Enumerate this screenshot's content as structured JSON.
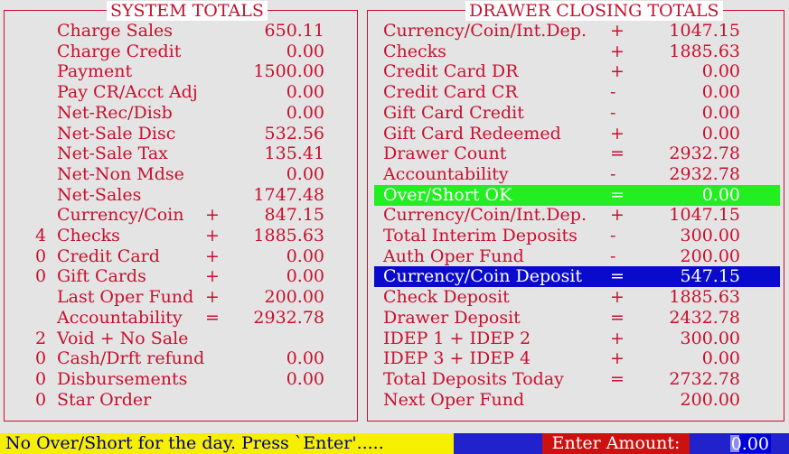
{
  "system_totals": {
    "title": "SYSTEM TOTALS",
    "rows": [
      {
        "count": "",
        "label": "Charge Sales",
        "op": "",
        "value": "650.11"
      },
      {
        "count": "",
        "label": "Charge Credit",
        "op": "",
        "value": "0.00"
      },
      {
        "count": "",
        "label": "Payment",
        "op": "",
        "value": "1500.00"
      },
      {
        "count": "",
        "label": "Pay CR/Acct Adj",
        "op": "",
        "value": "0.00"
      },
      {
        "count": "",
        "label": "Net-Rec/Disb",
        "op": "",
        "value": "0.00"
      },
      {
        "count": "",
        "label": "Net-Sale Disc",
        "op": "",
        "value": "532.56"
      },
      {
        "count": "",
        "label": "Net-Sale Tax",
        "op": "",
        "value": "135.41"
      },
      {
        "count": "",
        "label": "Net-Non Mdse",
        "op": "",
        "value": "0.00"
      },
      {
        "count": "",
        "label": "Net-Sales",
        "op": "",
        "value": "1747.48"
      },
      {
        "count": "",
        "label": "Currency/Coin",
        "op": "+",
        "value": "847.15"
      },
      {
        "count": "4",
        "label": "Checks",
        "op": "+",
        "value": "1885.63"
      },
      {
        "count": "0",
        "label": "Credit Card",
        "op": "+",
        "value": "0.00"
      },
      {
        "count": "0",
        "label": "Gift Cards",
        "op": "+",
        "value": "0.00"
      },
      {
        "count": "",
        "label": "Last Oper Fund",
        "op": "+",
        "value": "200.00"
      },
      {
        "count": "",
        "label": "Accountability",
        "op": "=",
        "value": "2932.78"
      },
      {
        "count": "2",
        "label": "Void + No Sale",
        "op": "",
        "value": ""
      },
      {
        "count": "0",
        "label": "Cash/Drft refund",
        "op": "",
        "value": "0.00"
      },
      {
        "count": "0",
        "label": "Disbursements",
        "op": "",
        "value": "0.00"
      },
      {
        "count": "0",
        "label": "Star Order",
        "op": "",
        "value": ""
      }
    ]
  },
  "drawer_closing_totals": {
    "title": "DRAWER CLOSING TOTALS",
    "rows": [
      {
        "label": "Currency/Coin/Int.Dep.",
        "op": "+",
        "value": "1047.15",
        "highlight": ""
      },
      {
        "label": "Checks",
        "op": "+",
        "value": "1885.63",
        "highlight": ""
      },
      {
        "label": "Credit Card DR",
        "op": "+",
        "value": "0.00",
        "highlight": ""
      },
      {
        "label": "Credit Card CR",
        "op": "-",
        "value": "0.00",
        "highlight": ""
      },
      {
        "label": "Gift Card Credit",
        "op": "-",
        "value": "0.00",
        "highlight": ""
      },
      {
        "label": "Gift Card Redeemed",
        "op": "+",
        "value": "0.00",
        "highlight": ""
      },
      {
        "label": "Drawer Count",
        "op": "=",
        "value": "2932.78",
        "highlight": ""
      },
      {
        "label": "Accountability",
        "op": "-",
        "value": "2932.78",
        "highlight": ""
      },
      {
        "label": "Over/Short OK",
        "op": "=",
        "value": "0.00",
        "highlight": "green"
      },
      {
        "label": "Currency/Coin/Int.Dep.",
        "op": "+",
        "value": "1047.15",
        "highlight": ""
      },
      {
        "label": "Total Interim Deposits",
        "op": "-",
        "value": "300.00",
        "highlight": ""
      },
      {
        "label": "Auth Oper Fund",
        "op": "-",
        "value": "200.00",
        "highlight": ""
      },
      {
        "label": "Currency/Coin Deposit",
        "op": "=",
        "value": "547.15",
        "highlight": "blue"
      },
      {
        "label": "Check Deposit",
        "op": "+",
        "value": "1885.63",
        "highlight": ""
      },
      {
        "label": "Drawer Deposit",
        "op": "=",
        "value": "2432.78",
        "highlight": ""
      },
      {
        "label": "IDEP 1 + IDEP 2",
        "op": "+",
        "value": "300.00",
        "highlight": ""
      },
      {
        "label": "IDEP 3 + IDEP 4",
        "op": "+",
        "value": "0.00",
        "highlight": ""
      },
      {
        "label": "Total Deposits Today",
        "op": "=",
        "value": "2732.78",
        "highlight": ""
      },
      {
        "label": "Next Oper Fund",
        "op": "",
        "value": "200.00",
        "highlight": ""
      }
    ]
  },
  "status_bar": {
    "message": "No Over/Short for the day. Press `Enter'.....",
    "prompt": "Enter Amount:",
    "amount_value": "0.00"
  },
  "colors": {
    "text": "#c8102e",
    "background": "#e4e4e4",
    "highlight_green": "#22ee22",
    "highlight_blue": "#0a0acc",
    "status_yellow": "#f7ef00",
    "prompt_red": "#cc1111"
  }
}
